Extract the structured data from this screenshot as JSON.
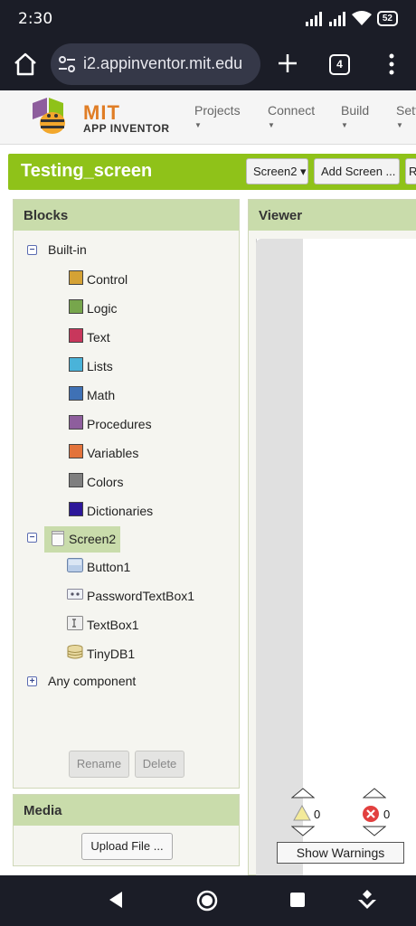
{
  "status_bar": {
    "time": "2:30",
    "battery": "52",
    "icons": [
      "signal-icon",
      "signal-icon",
      "wifi-icon",
      "battery-icon"
    ]
  },
  "browser": {
    "url": "i2.appinventor.mit.edu",
    "tab_count": "4",
    "icons": [
      "home-icon",
      "tune-icon",
      "plus-icon",
      "more-icon"
    ]
  },
  "app_header": {
    "logo_mit": "MIT",
    "logo_app_inventor": "APP INVENTOR",
    "menus": [
      "Projects",
      "Connect",
      "Build",
      "Sett"
    ]
  },
  "project_bar": {
    "project_name": "Testing_screen",
    "screen_select": "Screen2 ▾",
    "add_screen": "Add Screen ...",
    "next_button": "R"
  },
  "blocks_panel": {
    "title": "Blocks",
    "builtin": {
      "label": "Built-in",
      "expander": "−",
      "items": [
        {
          "label": "Control",
          "color": "#d5a235"
        },
        {
          "label": "Logic",
          "color": "#77a64c"
        },
        {
          "label": "Text",
          "color": "#c8375c"
        },
        {
          "label": "Lists",
          "color": "#4ab3d9"
        },
        {
          "label": "Math",
          "color": "#3f71b5"
        },
        {
          "label": "Procedures",
          "color": "#8e5e9d"
        },
        {
          "label": "Variables",
          "color": "#e3733b"
        },
        {
          "label": "Colors",
          "color": "#7f7f7f"
        },
        {
          "label": "Dictionaries",
          "color": "#2d1799"
        }
      ]
    },
    "screen": {
      "label": "Screen2",
      "expander": "−",
      "components": [
        {
          "label": "Button1",
          "icon": "button-icon"
        },
        {
          "label": "PasswordTextBox1",
          "icon": "password-textbox-icon"
        },
        {
          "label": "TextBox1",
          "icon": "textbox-icon"
        },
        {
          "label": "TinyDB1",
          "icon": "database-icon"
        }
      ]
    },
    "any_component": {
      "label": "Any component",
      "expander": "+"
    },
    "rename_button": "Rename",
    "delete_button": "Delete"
  },
  "media_panel": {
    "title": "Media",
    "upload_button": "Upload File ..."
  },
  "viewer_panel": {
    "title": "Viewer",
    "warnings_count": "0",
    "errors_count": "0",
    "show_warnings_button": "Show Warnings"
  },
  "nav_bar": {
    "icons": [
      "back-icon",
      "home-circle-icon",
      "recents-icon",
      "assistant-icon"
    ]
  }
}
